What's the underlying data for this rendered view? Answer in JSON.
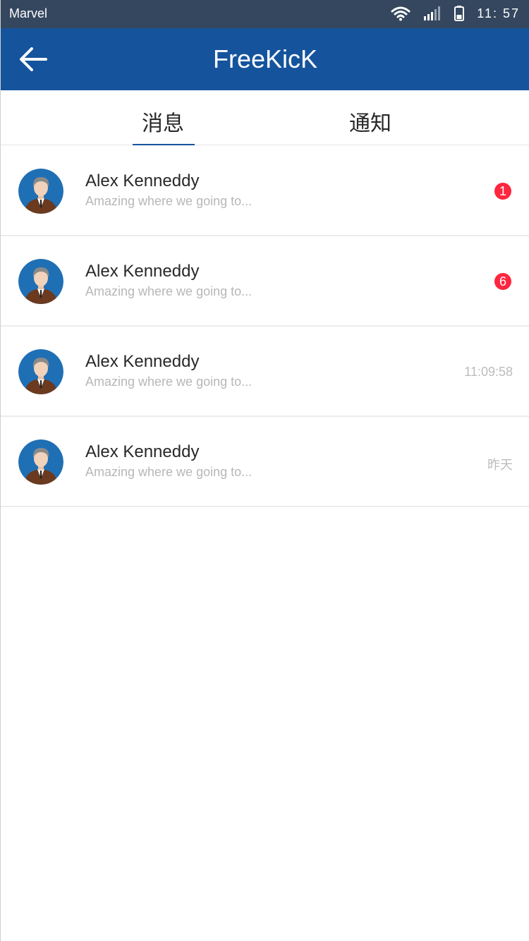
{
  "status_bar": {
    "carrier": "Marvel",
    "time": "11: 57"
  },
  "header": {
    "title": "FreeKicK"
  },
  "tabs": [
    {
      "label": "消息",
      "active": true
    },
    {
      "label": "通知",
      "active": false
    }
  ],
  "messages": [
    {
      "name": "Alex Kenneddy",
      "preview": "Amazing where we going to...",
      "badge": "1"
    },
    {
      "name": "Alex Kenneddy",
      "preview": "Amazing where we going to...",
      "badge": "6"
    },
    {
      "name": "Alex Kenneddy",
      "preview": "Amazing where we going to...",
      "time": "11:09:58"
    },
    {
      "name": "Alex Kenneddy",
      "preview": "Amazing where we going to...",
      "time": "昨天"
    }
  ],
  "colors": {
    "header_bg": "#15549C",
    "status_bg": "#34475F",
    "badge": "#FF263F",
    "name_text": "#282828",
    "preview_text": "#b7b7b7",
    "time_text": "#bcbcbc"
  },
  "icons": [
    "back-arrow-icon",
    "wifi-icon",
    "signal-icon",
    "battery-icon",
    "avatar-person-icon"
  ]
}
